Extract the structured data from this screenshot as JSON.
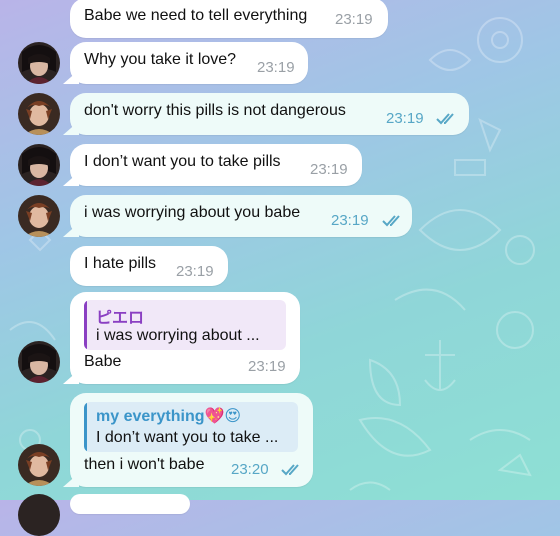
{
  "colors": {
    "bubble_in": "#ffffff",
    "bubble_out": "#eefbf9",
    "time_out": "#57a7c6",
    "reply_purple": "#8a3fc2",
    "reply_blue": "#3b95c9"
  },
  "messages": [
    {
      "text": "Babe we need to tell everything",
      "time": "23:19"
    },
    {
      "text": "Why you take it love?",
      "time": "23:19"
    },
    {
      "text": "don't worry this pills is not dangerous",
      "time": "23:19",
      "status_icon": "double-check-icon"
    },
    {
      "text": "I don’t want you to take pills",
      "time": "23:19"
    },
    {
      "text": "i was worrying about you babe",
      "time": "23:19",
      "status_icon": "double-check-icon"
    },
    {
      "text": "I hate pills",
      "time": "23:19"
    },
    {
      "reply_name": "ピエロ",
      "reply_text": "i was worrying about ...",
      "text": "Babe",
      "time": "23:19"
    },
    {
      "reply_name": "my everything💖😍",
      "reply_text": "I don’t want you to take ...",
      "text": "then i won't babe",
      "time": "23:20",
      "status_icon": "double-check-icon"
    }
  ]
}
